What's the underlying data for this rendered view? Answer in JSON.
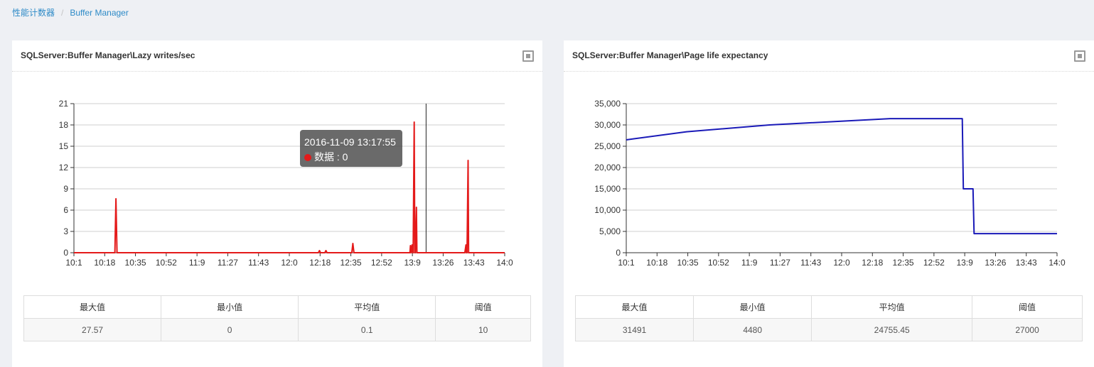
{
  "breadcrumb": {
    "parent": "性能计数器",
    "separator": "/",
    "current": "Buffer Manager"
  },
  "panels": [
    {
      "title": "SQLServer:Buffer Manager\\Lazy writes/sec",
      "stats_headers": [
        "最大值",
        "最小值",
        "平均值",
        "阈值"
      ],
      "stats_values": [
        "27.57",
        "0",
        "0.1",
        "10"
      ],
      "tooltip": {
        "time": "2016-11-09 13:17:55",
        "series": "数据",
        "separator": " : ",
        "value": "0"
      }
    },
    {
      "title": "SQLServer:Buffer Manager\\Page life expectancy",
      "stats_headers": [
        "最大值",
        "最小值",
        "平均值",
        "阈值"
      ],
      "stats_values": [
        "31491",
        "4480",
        "24755.45",
        "27000"
      ]
    }
  ],
  "colors": {
    "series_left": "#e41a1a",
    "series_right": "#1a1ab8",
    "link": "#2d8ac7"
  },
  "icons": [
    "expand-icon",
    "tooltip-dot-icon"
  ],
  "chart_data": [
    {
      "type": "line",
      "categories": [
        "10:1",
        "10:18",
        "10:35",
        "10:52",
        "11:9",
        "11:27",
        "11:43",
        "12:0",
        "12:18",
        "12:35",
        "12:52",
        "13:9",
        "13:26",
        "13:43",
        "14:0"
      ],
      "ylim": [
        0,
        21
      ],
      "yticks": [
        "0",
        "3",
        "6",
        "9",
        "12",
        "15",
        "18",
        "21"
      ],
      "grid": true,
      "crosshair_x": 13.27,
      "series": [
        {
          "x": [
            10.0,
            10.38,
            10.39,
            10.4,
            10.41,
            10.42,
            12.27,
            12.28,
            12.29,
            12.33,
            12.34,
            12.35,
            12.58,
            12.59,
            12.6,
            13.12,
            13.125,
            13.13,
            13.14,
            13.145,
            13.15,
            13.16,
            13.165,
            13.17,
            13.18,
            13.185,
            13.19,
            13.2,
            13.205,
            13.21,
            13.22,
            13.63,
            13.64,
            13.645,
            13.65,
            13.66,
            13.665,
            13.67,
            13.68,
            13.685,
            13.69,
            13.7,
            14.0
          ],
          "y": [
            0,
            0,
            7.6,
            0,
            0,
            0,
            0,
            0.3,
            0,
            0,
            0.3,
            0,
            0,
            1.3,
            0,
            0,
            1.0,
            0,
            1.1,
            0,
            0,
            18.4,
            0,
            0,
            6.4,
            0,
            0,
            0,
            0,
            0,
            0,
            0,
            1.1,
            0,
            0,
            13,
            0,
            0,
            0,
            0,
            0,
            0,
            0
          ]
        }
      ]
    },
    {
      "type": "line",
      "categories": [
        "10:1",
        "10:18",
        "10:35",
        "10:52",
        "11:9",
        "11:27",
        "11:43",
        "12:0",
        "12:18",
        "12:35",
        "12:52",
        "13:9",
        "13:26",
        "13:43",
        "14:0"
      ],
      "ylim": [
        0,
        35000
      ],
      "yticks": [
        "0",
        "5,000",
        "10,000",
        "15,000",
        "20,000",
        "25,000",
        "30,000",
        "35,000"
      ],
      "grid": true,
      "series": [
        {
          "x": [
            10.0,
            10.56,
            11.33,
            12.45,
            13.12,
            13.13,
            13.22,
            13.23,
            14.0
          ],
          "y": [
            26500,
            28400,
            30000,
            31491,
            31491,
            15000,
            15000,
            4480,
            4480
          ]
        }
      ]
    }
  ]
}
